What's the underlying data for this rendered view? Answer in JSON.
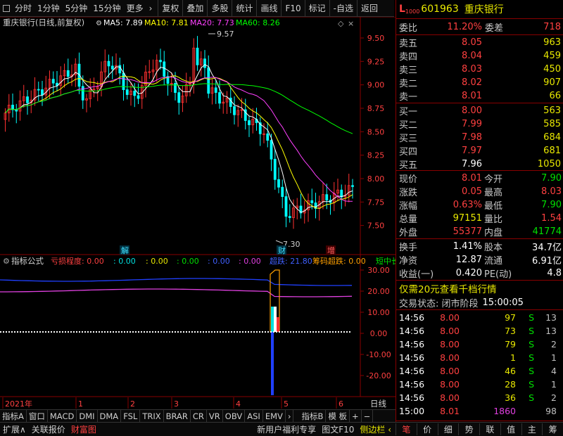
{
  "toolbar": {
    "periods": [
      "分时",
      "1分钟",
      "5分钟",
      "15分钟",
      "更多"
    ],
    "more_arrow": "›",
    "buttons": [
      "复权",
      "叠加",
      "多股",
      "统计",
      "画线",
      "F10",
      "标记",
      "-自选",
      "返回"
    ]
  },
  "chart": {
    "stock_title": "重庆银行(日线,前复权)",
    "ma5": "MA5: 7.89",
    "ma10": "MA10: 7.81",
    "ma20": "MA20: 7.73",
    "ma60": "MA60: 8.26",
    "max_label": "9.57",
    "min_label": "7.30",
    "price_ticks": [
      "9.50",
      "9.25",
      "9.00",
      "8.75",
      "8.50",
      "8.25",
      "8.00",
      "7.75",
      "7.50"
    ],
    "event_labels": [
      "解",
      "财",
      "增"
    ],
    "colors": {
      "ma5": "#ffffff",
      "ma10": "#ffff00",
      "ma20": "#ff40ff",
      "ma60": "#00ff00",
      "up": "#ff3030",
      "down": "#00ffff"
    }
  },
  "indicator": {
    "prefix": "指标公式",
    "items": [
      {
        "text": "亏损程度: 0.00",
        "color": "#ff4040"
      },
      {
        "text": ": 0.00",
        "color": "#00e0e0"
      },
      {
        "text": ": 0.00",
        "color": "#e8e800"
      },
      {
        "text": ": 0.00",
        "color": "#00e000"
      },
      {
        "text": ": 0.00",
        "color": "#4060ff"
      },
      {
        "text": ": 0.00",
        "color": "#e040e0"
      },
      {
        "text": "超跌: 21.80",
        "color": "#4060ff"
      },
      {
        "text": "筹码超跌: 0.00",
        "color": "#ffa000"
      },
      {
        "text": "短中长",
        "color": "#00e000"
      }
    ],
    "ticks": [
      "30.00",
      "20.00",
      "10.00",
      "0.00",
      "-10.00",
      "-20.00"
    ]
  },
  "time_axis": {
    "labels": [
      "2021年",
      "1",
      "2",
      "3",
      "4",
      "5",
      "6"
    ],
    "right_label": "日线"
  },
  "indicator_tabs": [
    "指标A",
    "窗口",
    "MACD",
    "DMI",
    "DMA",
    "FSL",
    "TRIX",
    "BRAR",
    "CR",
    "VR",
    "OBV",
    "ASI",
    "EMV",
    "›",
    "指标B",
    "模 板",
    "+",
    "−"
  ],
  "status_bar": {
    "left": [
      "扩展∧",
      "关联报价",
      "财富图"
    ],
    "right": [
      "新用户福利专享",
      "图文F10",
      "侧边栏 ‹"
    ]
  },
  "quote": {
    "header_letter": "L",
    "header_sub": "1000",
    "code": "601963",
    "name": "重庆银行",
    "weibi_label": "委比",
    "weibi_value": "11.20%",
    "weicha_label": "委差",
    "weicha_value": "718",
    "sells": [
      {
        "label": "卖五",
        "price": "8.05",
        "vol": "963"
      },
      {
        "label": "卖四",
        "price": "8.04",
        "vol": "459"
      },
      {
        "label": "卖三",
        "price": "8.03",
        "vol": "450"
      },
      {
        "label": "卖二",
        "price": "8.02",
        "vol": "907"
      },
      {
        "label": "卖一",
        "price": "8.01",
        "vol": "66"
      }
    ],
    "buys": [
      {
        "label": "买一",
        "price": "8.00",
        "vol": "563",
        "pcolor": "red"
      },
      {
        "label": "买二",
        "price": "7.99",
        "vol": "585",
        "pcolor": "red"
      },
      {
        "label": "买三",
        "price": "7.98",
        "vol": "684",
        "pcolor": "red"
      },
      {
        "label": "买四",
        "price": "7.97",
        "vol": "681",
        "pcolor": "red"
      },
      {
        "label": "买五",
        "price": "7.96",
        "vol": "1050",
        "pcolor": "white"
      }
    ],
    "stats": [
      {
        "l1": "现价",
        "v1": "8.01",
        "c1": "red",
        "l2": "今开",
        "v2": "7.90",
        "c2": "green"
      },
      {
        "l1": "涨跌",
        "v1": "0.05",
        "c1": "red",
        "l2": "最高",
        "v2": "8.03",
        "c2": "red"
      },
      {
        "l1": "涨幅",
        "v1": "0.63%",
        "c1": "red",
        "l2": "最低",
        "v2": "7.90",
        "c2": "green"
      },
      {
        "l1": "总量",
        "v1": "97151",
        "c1": "yellow",
        "l2": "量比",
        "v2": "1.54",
        "c2": "red"
      },
      {
        "l1": "外盘",
        "v1": "55377",
        "c1": "red",
        "l2": "内盘",
        "v2": "41774",
        "c2": "green"
      }
    ],
    "stats2": [
      {
        "l1": "换手",
        "v1": "1.41%",
        "l2": "股本",
        "v2": "34.7亿"
      },
      {
        "l1": "净资",
        "v1": "12.87",
        "l2": "流通",
        "v2": "6.91亿"
      },
      {
        "l1": "收益(一)",
        "v1": "0.420",
        "l2": "PE(动)",
        "v2": "4.8"
      }
    ],
    "promo": "仅需20元查看千档行情",
    "trade_status_label": "交易状态: 闭市阶段",
    "trade_status_time": "15:00:05",
    "ticks": [
      {
        "t": "14:56",
        "p": "8.00",
        "v": "97",
        "s": "S",
        "n": "13"
      },
      {
        "t": "14:56",
        "p": "8.00",
        "v": "73",
        "s": "S",
        "n": "13"
      },
      {
        "t": "14:56",
        "p": "8.00",
        "v": "79",
        "s": "S",
        "n": "2"
      },
      {
        "t": "14:56",
        "p": "8.00",
        "v": "1",
        "s": "S",
        "n": "1"
      },
      {
        "t": "14:56",
        "p": "8.00",
        "v": "46",
        "s": "S",
        "n": "4"
      },
      {
        "t": "14:56",
        "p": "8.00",
        "v": "28",
        "s": "S",
        "n": "1"
      },
      {
        "t": "14:56",
        "p": "8.00",
        "v": "36",
        "s": "S",
        "n": "2"
      },
      {
        "t": "15:00",
        "p": "8.01",
        "v": "1860",
        "s": "",
        "n": "98"
      }
    ],
    "bottom_tabs": [
      "笔",
      "价",
      "细",
      "势",
      "联",
      "值",
      "主",
      "筹"
    ]
  }
}
